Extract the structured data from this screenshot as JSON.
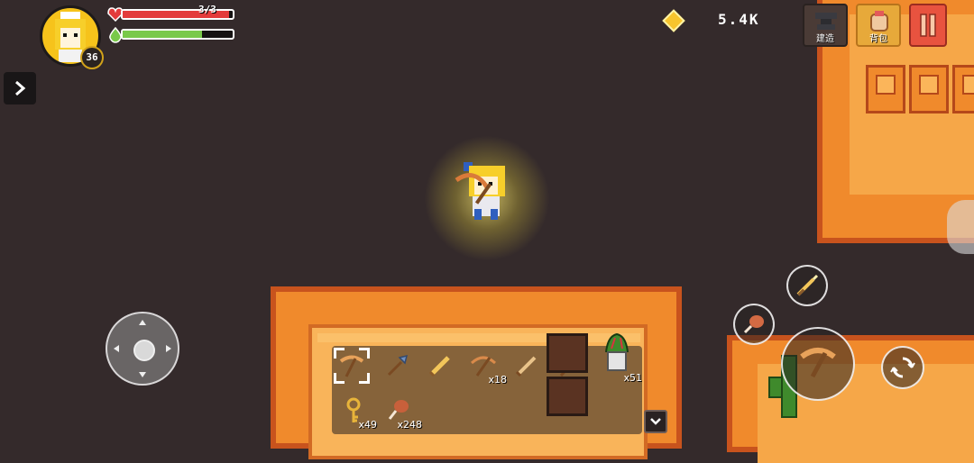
{
  "player": {
    "level": "36",
    "hp_text": "3/3",
    "hp_fraction": 0.97,
    "energy_fraction": 0.72
  },
  "currency": {
    "gems": "5.4K"
  },
  "top_buttons": [
    {
      "label": "建造",
      "icon": "anvil-icon"
    },
    {
      "label": "背包",
      "icon": "backpack-icon"
    },
    {
      "label": "",
      "icon": "pause-icon"
    }
  ],
  "hotbar": {
    "slots": [
      {
        "icon": "pickaxe-icon",
        "count": "",
        "selected": true
      },
      {
        "icon": "shovel-icon",
        "count": ""
      },
      {
        "icon": "golden-sword-icon",
        "count": ""
      },
      {
        "icon": "crossbow-icon",
        "count": "x18"
      },
      {
        "icon": "wooden-sword-icon",
        "count": ""
      },
      {
        "icon": "hammer-icon",
        "count": ""
      },
      {
        "icon": "plant-pot-icon",
        "count": "x51"
      },
      {
        "icon": "key-icon",
        "count": "x49"
      },
      {
        "icon": "meat-icon",
        "count": "x248"
      }
    ]
  },
  "colors": {
    "hp": "#e33b3b",
    "energy": "#79c94a",
    "gem": "#f7c52e",
    "background": "#342a2b"
  }
}
